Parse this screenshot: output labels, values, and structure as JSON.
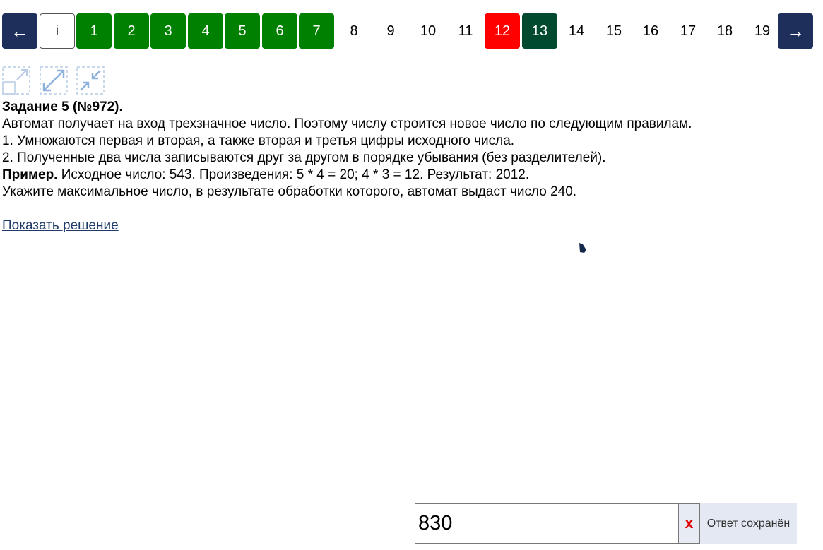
{
  "nav": {
    "prev_label": "←",
    "info_label": "i",
    "pages": [
      {
        "label": "1",
        "state": "ok"
      },
      {
        "label": "2",
        "state": "ok"
      },
      {
        "label": "3",
        "state": "ok"
      },
      {
        "label": "4",
        "state": "ok"
      },
      {
        "label": "5",
        "state": "ok"
      },
      {
        "label": "6",
        "state": "ok"
      },
      {
        "label": "7",
        "state": "ok"
      },
      {
        "label": "8",
        "state": "plain"
      },
      {
        "label": "9",
        "state": "plain"
      },
      {
        "label": "10",
        "state": "plain"
      },
      {
        "label": "11",
        "state": "plain"
      },
      {
        "label": "12",
        "state": "wrong"
      },
      {
        "label": "13",
        "state": "current"
      },
      {
        "label": "14",
        "state": "plain"
      },
      {
        "label": "15",
        "state": "plain"
      },
      {
        "label": "16",
        "state": "plain"
      },
      {
        "label": "17",
        "state": "plain"
      },
      {
        "label": "18",
        "state": "plain"
      },
      {
        "label": "19",
        "state": "plain"
      }
    ],
    "next_label": "→"
  },
  "tools": [
    "expand-corner-icon",
    "fullscreen-icon",
    "shrink-icon"
  ],
  "task": {
    "title": "Задание 5 (№972).",
    "lines": [
      "Автомат получает на вход трехзначное число. Поэтому числу строится новое число по следующим правилам.",
      "1. Умножаются первая и вторая, а также вторая и третья цифры исходного числа.",
      "2. Полученные два числа записываются друг за другом в порядке убывания (без разделителей)."
    ],
    "example_label": "Пример.",
    "example_text": " Исходное число: 543. Произведения: 5 * 4 = 20; 4 * 3 = 12. Результат: 2012.",
    "question": "Укажите максимальное число, в результате обработки которого, автомат выдаст число 240.",
    "show_solution": "Показать решение"
  },
  "answer": {
    "value": "830",
    "clear_label": "x",
    "status": "Ответ сохранён"
  },
  "colors": {
    "arrow": "#1f2f5c",
    "ok": "#008000",
    "wrong": "#ff0000",
    "current": "#014a2f",
    "link": "#1f3a68"
  }
}
